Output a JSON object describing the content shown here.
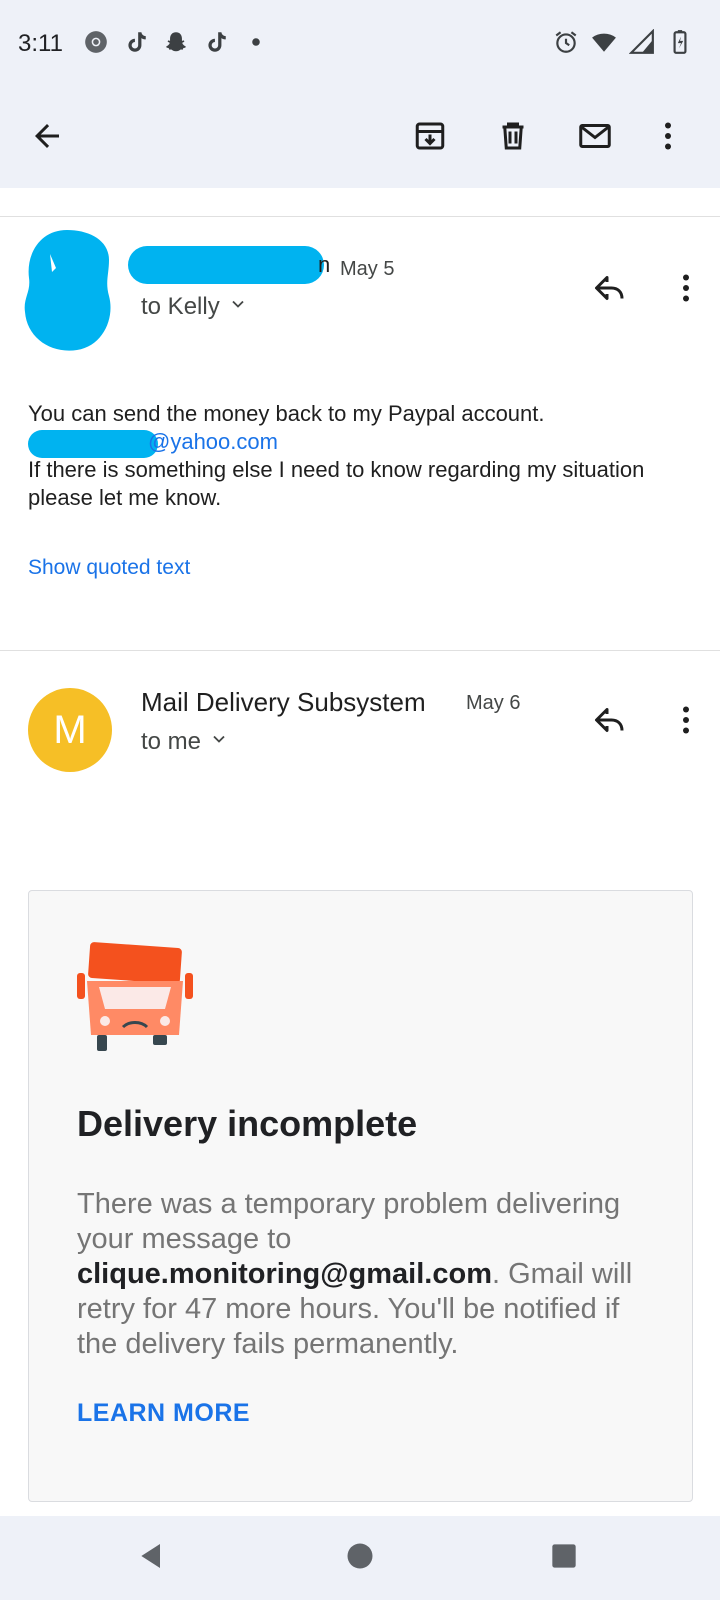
{
  "status_bar": {
    "time": "3:11",
    "left_icons": [
      "chrome-icon",
      "tiktok-icon",
      "snapchat-icon",
      "tiktok-icon",
      "dot-icon"
    ],
    "right_icons": [
      "alarm-icon",
      "wifi-icon",
      "signal-icon",
      "battery-icon"
    ]
  },
  "toolbar": {
    "icons": [
      "back-arrow-icon",
      "archive-icon",
      "delete-icon",
      "mark-unread-icon",
      "more-vert-icon"
    ]
  },
  "message1": {
    "sender_visible": "n",
    "date": "May 5",
    "to": "to Kelly",
    "body_line1": "You can send the money back to my Paypal account.",
    "email_visible": "@yahoo.com",
    "body_line2": "If there is something else I need to know regarding my situation please let me know.",
    "show_quoted": "Show quoted text"
  },
  "message2": {
    "avatar_letter": "M",
    "sender": "Mail Delivery Subsystem",
    "date": "May 6",
    "to": "to me"
  },
  "card": {
    "title": "Delivery incomplete",
    "body_pre": "There was a temporary problem delivering your message to ",
    "email": "clique.monitoring@gmail.com",
    "body_post": ". Gmail will retry for 47 more hours. You'll be notified if the delivery fails permanently.",
    "link": "LEARN MORE"
  },
  "colors": {
    "accent": "#1a73e8",
    "avatar_m": "#f6bf26",
    "redaction": "#00b3f0",
    "truck": "#f4511e"
  }
}
